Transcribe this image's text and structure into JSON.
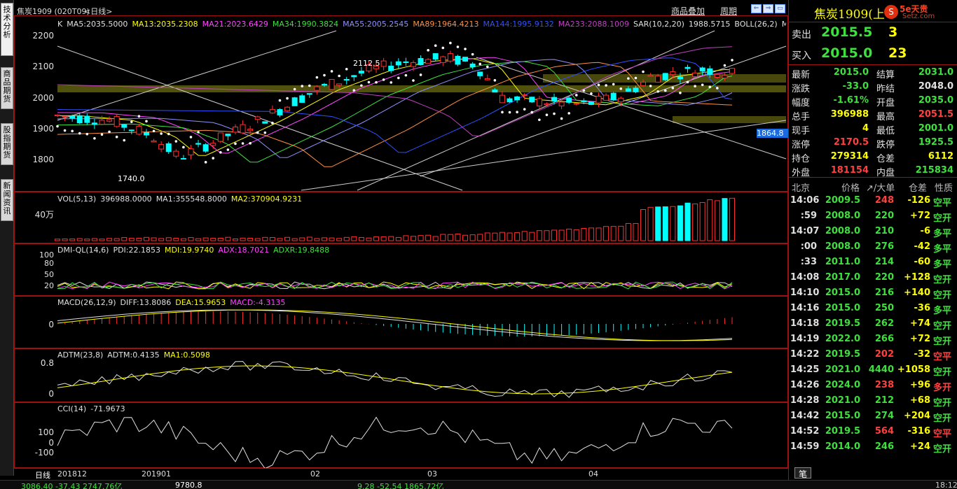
{
  "side_tabs": [
    "技术分析",
    "商品期货",
    "股指期货",
    "新闻资讯"
  ],
  "header": {
    "title": "焦炭1909 (020T09)",
    "period": "<日线>",
    "link_overlay": "商品叠加",
    "link_period": "周期"
  },
  "main_ma_line": [
    {
      "text": "K",
      "color": "#e0e0e0"
    },
    {
      "text": "MA5:2035.5000",
      "color": "#e0e0e0"
    },
    {
      "text": "MA13:2035.2308",
      "color": "#ffff00"
    },
    {
      "text": "MA21:2023.6429",
      "color": "#ff44ff"
    },
    {
      "text": "MA34:1990.3824",
      "color": "#3ee03e"
    },
    {
      "text": "MA55:2005.2545",
      "color": "#9090ff"
    },
    {
      "text": "MA89:1964.4213",
      "color": "#ff9040"
    },
    {
      "text": "MA144:1995.9132",
      "color": "#3050ff"
    },
    {
      "text": "MA233:2088.1009",
      "color": "#c040c0"
    },
    {
      "text": "SAR(10,2,20)",
      "color": "#e0e0e0"
    },
    {
      "text": "1988.5715",
      "color": "#e0e0e0"
    },
    {
      "text": "BOLL(26,2)",
      "color": "#e0e0e0"
    },
    {
      "text": "M",
      "color": "#e0e0e0"
    }
  ],
  "price_axis": [
    "2200",
    "2100",
    "2000",
    "1900",
    "1800"
  ],
  "price_annotations": {
    "high": "2112.5",
    "low": "1740.0",
    "current_marker": "1864.8"
  },
  "vol_panel": {
    "title": "VOL(5,13)",
    "values": [
      {
        "text": "396988.0000",
        "color": "#e0e0e0"
      },
      {
        "text": "MA1:355548.8000",
        "color": "#e0e0e0"
      },
      {
        "text": "MA2:370904.9231",
        "color": "#ffff00"
      }
    ],
    "axis": "40万"
  },
  "dmi_panel": {
    "title": "DMI-QL(14,6)",
    "values": [
      {
        "text": "PDI:22.1853",
        "color": "#e0e0e0"
      },
      {
        "text": "MDI:19.9740",
        "color": "#ffff00"
      },
      {
        "text": "ADX:18.7021",
        "color": "#ff44ff"
      },
      {
        "text": "ADXR:19.8488",
        "color": "#3ee03e"
      }
    ],
    "axis": [
      "100",
      "80",
      "50",
      "20"
    ]
  },
  "macd_panel": {
    "title": "MACD(26,12,9)",
    "values": [
      {
        "text": "DIFF:13.8086",
        "color": "#e0e0e0"
      },
      {
        "text": "DEA:15.9653",
        "color": "#ffff00"
      },
      {
        "text": "MACD:-4.3135",
        "color": "#ff44ff"
      }
    ],
    "axis": [
      "0"
    ]
  },
  "adtm_panel": {
    "title": "ADTM(23,8)",
    "values": [
      {
        "text": "ADTM:0.4135",
        "color": "#e0e0e0"
      },
      {
        "text": "MA1:0.5098",
        "color": "#ffff00"
      }
    ],
    "axis": [
      "0.8",
      "0"
    ]
  },
  "cci_panel": {
    "title": "CCI(14)",
    "values": [
      {
        "text": "-71.9673",
        "color": "#e0e0e0"
      }
    ],
    "axis": [
      "100",
      "0",
      "-100"
    ]
  },
  "x_axis": {
    "period_label": "日线",
    "dates": [
      "201812",
      "201901",
      "02",
      "03",
      "04"
    ]
  },
  "quote": {
    "name": "焦炭1909(上",
    "sell_label": "卖出",
    "sell_price": "2015.5",
    "sell_vol": "3",
    "buy_label": "买入",
    "buy_price": "2015.0",
    "buy_vol": "23",
    "rows": [
      {
        "l1": "最新",
        "v1": "2015.0",
        "c1": "green",
        "l2": "结算",
        "v2": "2031.0",
        "c2": "green"
      },
      {
        "l1": "涨跌",
        "v1": "-33.0",
        "c1": "green",
        "l2": "昨结",
        "v2": "2048.0",
        "c2": "white"
      },
      {
        "l1": "幅度",
        "v1": "-1.61%",
        "c1": "green",
        "l2": "开盘",
        "v2": "2035.0",
        "c2": "green"
      },
      {
        "l1": "总手",
        "v1": "396988",
        "c1": "yellow",
        "l2": "最高",
        "v2": "2051.5",
        "c2": "red"
      },
      {
        "l1": "现手",
        "v1": "4",
        "c1": "yellow",
        "l2": "最低",
        "v2": "2001.0",
        "c2": "green"
      },
      {
        "l1": "涨停",
        "v1": "2170.5",
        "c1": "red",
        "l2": "跌停",
        "v2": "1925.5",
        "c2": "green"
      },
      {
        "l1": "持仓",
        "v1": "279314",
        "c1": "yellow",
        "l2": "仓差",
        "v2": "6112",
        "c2": "yellow"
      },
      {
        "l1": "外盘",
        "v1": "181154",
        "c1": "red",
        "l2": "内盘",
        "v2": "215834",
        "c2": "green"
      }
    ],
    "ticks_header": {
      "c1": "北京",
      "c2": "价格",
      "c3": "↗/大单",
      "c4": "仓差",
      "c5": "性质"
    },
    "ticks": [
      {
        "t": "14:06",
        "p": "2009.5",
        "v": "248",
        "vc": "red",
        "d": "-126",
        "n": "空平",
        "nc": "green"
      },
      {
        "t": ":59",
        "p": "2008.0",
        "v": "220",
        "vc": "green",
        "d": "+72",
        "n": "空开",
        "nc": "green"
      },
      {
        "t": "14:07",
        "p": "2008.0",
        "v": "210",
        "vc": "green",
        "d": "-6",
        "n": "多平",
        "nc": "green"
      },
      {
        "t": ":00",
        "p": "2008.0",
        "v": "276",
        "vc": "green",
        "d": "-42",
        "n": "多平",
        "nc": "green"
      },
      {
        "t": ":33",
        "p": "2011.0",
        "v": "214",
        "vc": "green",
        "d": "-60",
        "n": "多平",
        "nc": "green"
      },
      {
        "t": "14:08",
        "p": "2017.0",
        "v": "220",
        "vc": "green",
        "d": "+128",
        "n": "空开",
        "nc": "green"
      },
      {
        "t": "14:10",
        "p": "2015.0",
        "v": "216",
        "vc": "green",
        "d": "+140",
        "n": "空开",
        "nc": "green"
      },
      {
        "t": "14:16",
        "p": "2015.0",
        "v": "250",
        "vc": "green",
        "d": "-36",
        "n": "多平",
        "nc": "green"
      },
      {
        "t": "14:18",
        "p": "2019.5",
        "v": "262",
        "vc": "green",
        "d": "+74",
        "n": "空开",
        "nc": "green"
      },
      {
        "t": "14:19",
        "p": "2022.0",
        "v": "266",
        "vc": "green",
        "d": "+72",
        "n": "空开",
        "nc": "green"
      },
      {
        "t": "14:22",
        "p": "2019.5",
        "v": "202",
        "vc": "red",
        "d": "-32",
        "n": "空平",
        "nc": "red"
      },
      {
        "t": "14:25",
        "p": "2021.0",
        "v": "4440",
        "vc": "green",
        "d": "+1058",
        "n": "空开",
        "nc": "green"
      },
      {
        "t": "14:26",
        "p": "2024.0",
        "v": "238",
        "vc": "red",
        "d": "+96",
        "n": "多开",
        "nc": "red"
      },
      {
        "t": "14:28",
        "p": "2021.0",
        "v": "212",
        "vc": "green",
        "d": "+68",
        "n": "空开",
        "nc": "green"
      },
      {
        "t": "14:42",
        "p": "2015.0",
        "v": "274",
        "vc": "green",
        "d": "+204",
        "n": "空开",
        "nc": "green"
      },
      {
        "t": "14:52",
        "p": "2019.5",
        "v": "564",
        "vc": "red",
        "d": "-316",
        "n": "空平",
        "nc": "red"
      },
      {
        "t": "14:59",
        "p": "2014.0",
        "v": "246",
        "vc": "green",
        "d": "+24",
        "n": "空开",
        "nc": "green"
      }
    ],
    "footer_tab": "笔"
  },
  "status": {
    "left": "3086.40  -37.43  2747.76亿",
    "mid": "9780.8",
    "right": "9.28  -52.54  1865.72亿",
    "time": "18:12"
  },
  "brand": {
    "logo_text": "5e天贵",
    "sub": "Setz.com"
  }
}
